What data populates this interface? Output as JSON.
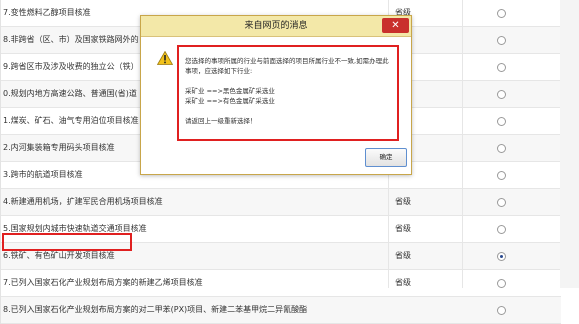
{
  "rows": [
    {
      "name": "7.变性燃料乙醇项目核准",
      "level": "省级",
      "selected": false
    },
    {
      "name": "8.非跨省（区、市）及国家铁路网外的",
      "level": "",
      "selected": false
    },
    {
      "name": "9.跨省区市及涉及收费的独立公（铁）",
      "level": "",
      "selected": false
    },
    {
      "name": "0.规划内地方高速公路、普通国(省)道",
      "level": "",
      "selected": false
    },
    {
      "name": "1.煤炭、矿石、油气专用泊位项目核准",
      "level": "",
      "selected": false
    },
    {
      "name": "2.内河集装箱专用码头项目核准",
      "level": "",
      "selected": false
    },
    {
      "name": "3.跨市的航道项目核准",
      "level": "",
      "selected": false
    },
    {
      "name": "4.新建通用机场，扩建军民合用机场项目核准",
      "level": "省级",
      "selected": false
    },
    {
      "name": "5.国家规划内城市快速轨道交通项目核准",
      "level": "省级",
      "selected": false
    },
    {
      "name": "6.铁矿、有色矿山开发项目核准",
      "level": "省级",
      "selected": true
    },
    {
      "name": "7.已列入国家石化产业规划布局方案的新建乙烯项目核准",
      "level": "省级",
      "selected": false
    },
    {
      "name": "8.已列入国家石化产业规划布局方案的对二甲苯(PX)项目、新建二苯基甲烷二异氰酸酯",
      "level": "",
      "selected": false
    }
  ],
  "dialog": {
    "title": "来自网页的消息",
    "close_glyph": "✕",
    "icon": "warning-icon",
    "line1": "您选择的事项所属的行业与前面选择的项目所属行业不一致,如需办理此",
    "line2": "事项，应选择如下行业:",
    "line3": "采矿业 ==>黑色金属矿采选业",
    "line4": "采矿业 ==>有色金属矿采选业",
    "line5": "请返回上一级重新选择！",
    "ok_label": "确定"
  },
  "colors": {
    "highlight": "#e02020",
    "dialog_title_bg": "#f3e8a8",
    "close_button": "#c9302c"
  }
}
